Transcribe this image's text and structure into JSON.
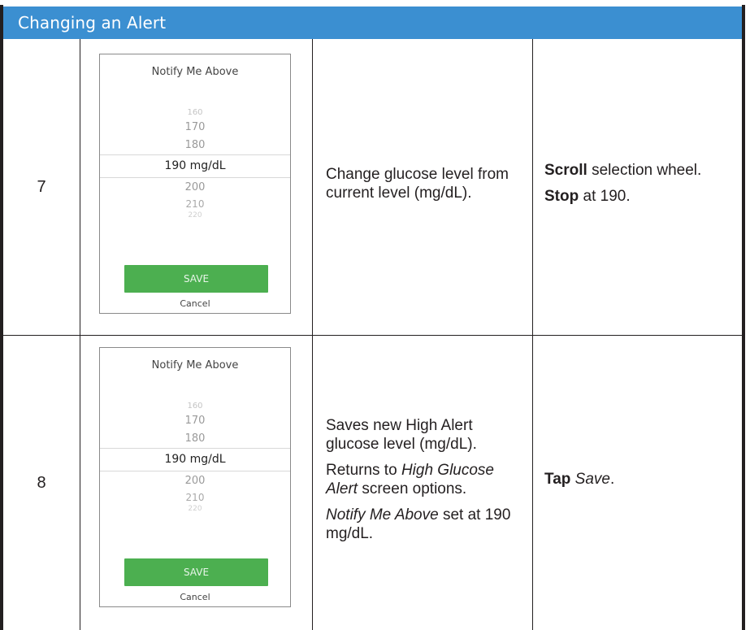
{
  "header": {
    "title": "Changing an Alert"
  },
  "rows": [
    {
      "step": "7",
      "screen": {
        "title": "Notify Me Above",
        "wheel": [
          "160",
          "170",
          "180",
          "190 mg/dL",
          "200",
          "210",
          "220"
        ],
        "save_label": "SAVE",
        "cancel_label": "Cancel"
      },
      "description": {
        "p1": "Change glucose level from current level (mg/dL)."
      },
      "action": {
        "line1_bold": "Scroll",
        "line1_rest": " selection wheel.",
        "line2_bold": "Stop",
        "line2_rest": " at 190."
      }
    },
    {
      "step": "8",
      "screen": {
        "title": "Notify Me Above",
        "wheel": [
          "160",
          "170",
          "180",
          "190 mg/dL",
          "200",
          "210",
          "220"
        ],
        "save_label": "SAVE",
        "cancel_label": "Cancel"
      },
      "description": {
        "p1": "Saves new High Alert glucose level (mg/dL).",
        "p2_pre": "Returns to ",
        "p2_italic": "High Glucose Alert",
        "p2_post": " screen options.",
        "p3_italic": "Notify Me Above",
        "p3_post": " set at 190 mg/dL."
      },
      "action": {
        "bold": "Tap",
        "italic": "Save",
        "post": "."
      }
    }
  ]
}
